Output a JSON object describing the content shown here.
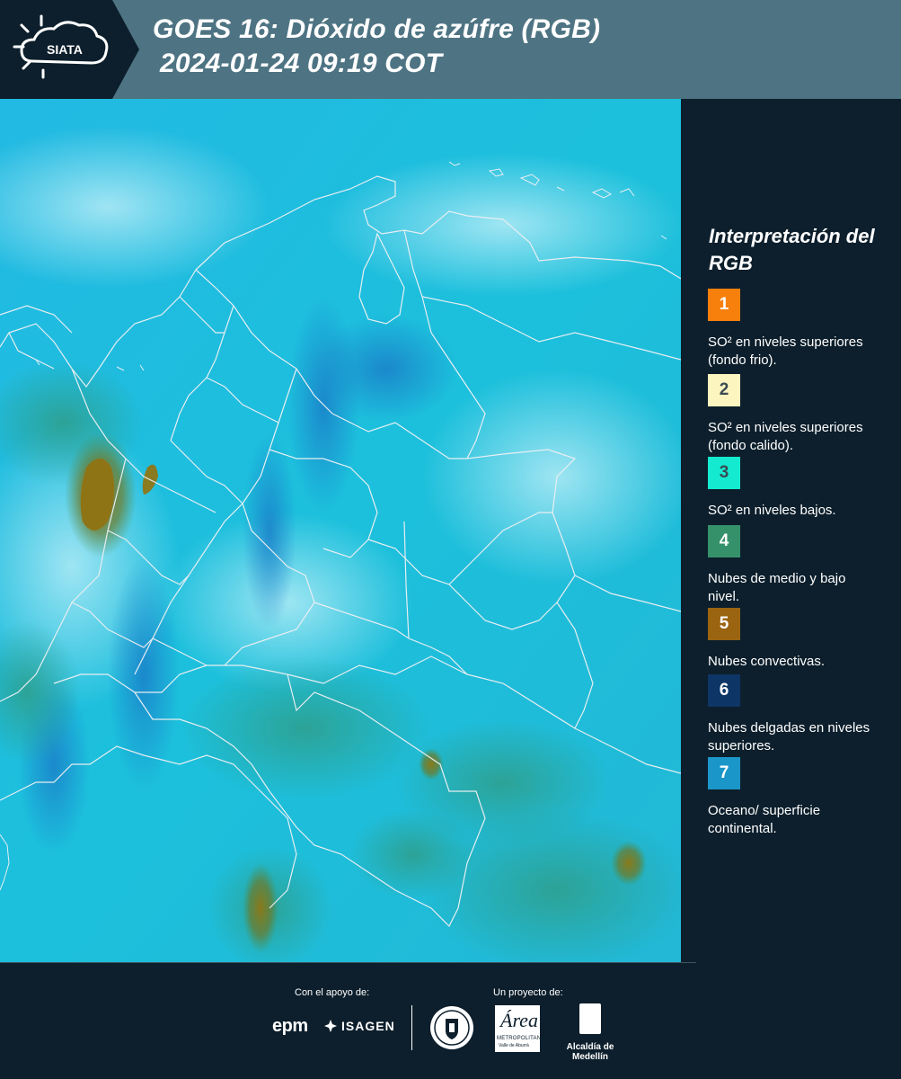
{
  "header": {
    "logo_text": "SIATA",
    "title_line1": "GOES 16: Dióxido de azúfre (RGB)",
    "title_line2": "2024-01-24 09:19 COT"
  },
  "legend": {
    "title": "Interpretación del RGB",
    "items": [
      {
        "number": "1",
        "color": "#f7800c",
        "text": "SO² en niveles superiores (fondo frio)."
      },
      {
        "number": "2",
        "color": "#fdf5c0",
        "text": "SO² en niveles superiores (fondo calido)."
      },
      {
        "number": "3",
        "color": "#14ead0",
        "text": "SO² en niveles bajos."
      },
      {
        "number": "4",
        "color": "#35916a",
        "text": "Nubes de medio y bajo nivel."
      },
      {
        "number": "5",
        "color": "#9a6410",
        "text": "Nubes convectivas."
      },
      {
        "number": "6",
        "color": "#0d3566",
        "text": "Nubes delgadas en niveles superiores."
      },
      {
        "number": "7",
        "color": "#1a96c8",
        "text": "Oceano/ superficie continental."
      }
    ]
  },
  "footer": {
    "support_label": "Con el apoyo de:",
    "project_label": "Un proyecto de:",
    "sponsor_1": "epm",
    "sponsor_2": "ISAGEN",
    "partner_area_1": "Área",
    "partner_area_2": "METROPOLITANA",
    "partner_area_3": "Valle de Aburrá",
    "partner_alcaldia": "Alcaldía de Medellín"
  },
  "map": {
    "background_color": "#1fb7e0",
    "border_color": "#e8eef2"
  }
}
